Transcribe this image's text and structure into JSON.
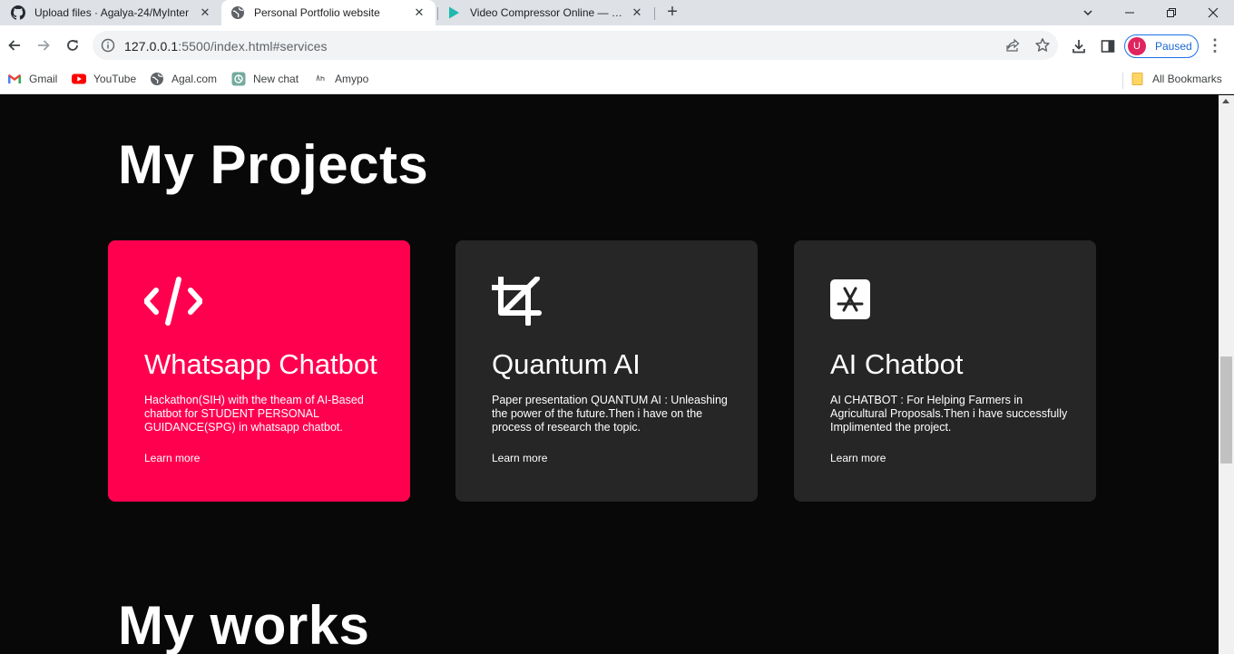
{
  "browser": {
    "tabs": [
      {
        "title": "Upload files · Agalya-24/MyInter",
        "icon": "github-icon"
      },
      {
        "title": "Personal Portfolio website",
        "icon": "globe-icon",
        "active": true
      },
      {
        "title": "Video Compressor Online — Clic",
        "icon": "play-icon"
      }
    ],
    "new_tab_label": "+",
    "url_host": "127.0.0.1",
    "url_rest": ":5500/index.html#services",
    "profile_initial": "U",
    "profile_status": "Paused",
    "bookmarks": [
      {
        "label": "Gmail",
        "icon": "gmail-icon"
      },
      {
        "label": "YouTube",
        "icon": "youtube-icon"
      },
      {
        "label": "Agal.com",
        "icon": "globe-icon"
      },
      {
        "label": "New chat",
        "icon": "chatgpt-icon"
      },
      {
        "label": "Amypo",
        "icon": "amypo-icon"
      }
    ],
    "all_bookmarks": "All Bookmarks"
  },
  "page": {
    "projects_title": "My Projects",
    "works_title": "My works",
    "projects": [
      {
        "title": "Whatsapp Chatbot",
        "icon": "code-icon",
        "description": "Hackathon(SIH) with the theam of AI-Based chatbot for STUDENT PERSONAL GUIDANCE(SPG) in whatsapp chatbot.",
        "link": "Learn more"
      },
      {
        "title": "Quantum AI",
        "icon": "crop-icon",
        "description": "Paper presentation QUANTUM AI : Unleashing the power of the future.Then i have on the process of research the topic.",
        "link": "Learn more"
      },
      {
        "title": "AI Chatbot",
        "icon": "app-store-icon",
        "description": "AI CHATBOT : For Helping Farmers in Agricultural Proposals.Then i have successfully Implimented the project.",
        "link": "Learn more"
      }
    ]
  },
  "colors": {
    "accent": "#ff004f",
    "card_bg": "#262626",
    "page_bg": "#080808"
  }
}
